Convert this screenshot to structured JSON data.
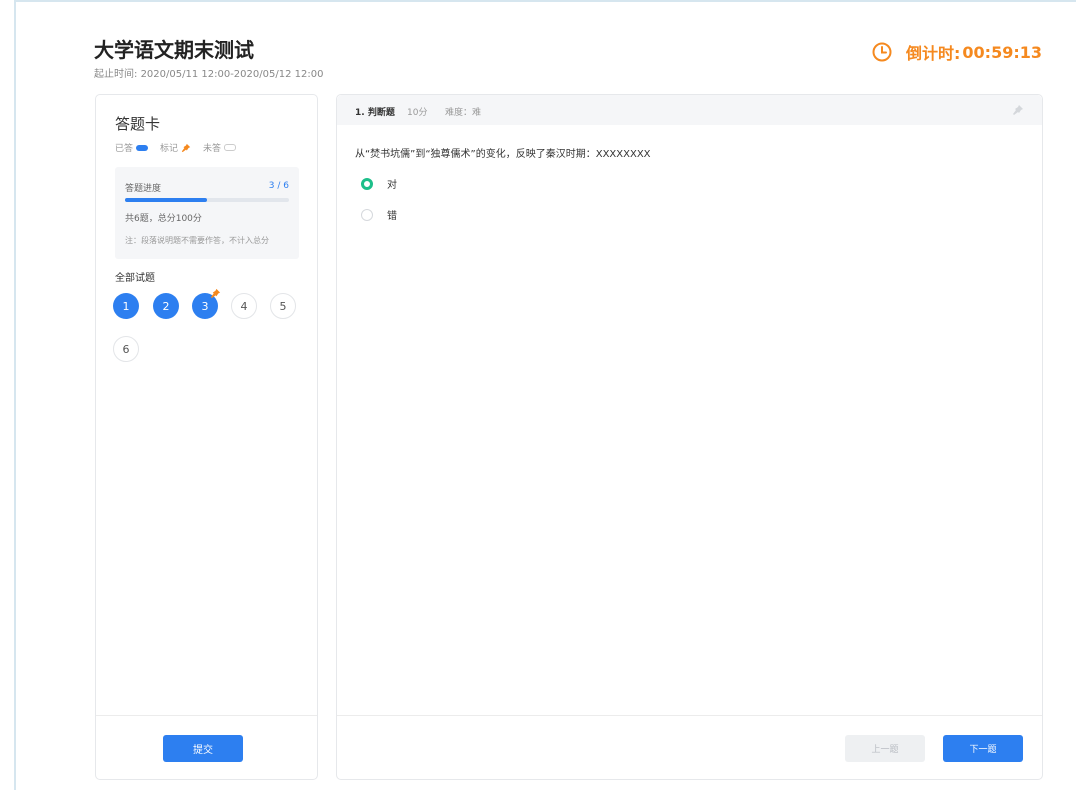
{
  "header": {
    "title": "大学语文期末测试",
    "time_range_label": "起止时间:",
    "time_range": "2020/05/11 12:00-2020/05/12 12:00",
    "countdown_label": "倒计时:",
    "countdown_value": "00:59:13",
    "countdown_color": "#f5891f"
  },
  "answer_card": {
    "title": "答题卡",
    "legend": {
      "answered": "已答",
      "marked": "标记",
      "unanswered": "未答"
    },
    "progress": {
      "label": "答题进度",
      "count": "3 / 6",
      "answered": 3,
      "total": 6,
      "summary": "共6题，总分100分",
      "note": "注：段落说明题不需要作答，不计入总分"
    },
    "all_questions_label": "全部试题",
    "questions": [
      {
        "number": "1",
        "state": "done",
        "marked": false
      },
      {
        "number": "2",
        "state": "done",
        "marked": false
      },
      {
        "number": "3",
        "state": "done",
        "marked": true
      },
      {
        "number": "4",
        "state": "todo",
        "marked": false
      },
      {
        "number": "5",
        "state": "todo",
        "marked": false
      },
      {
        "number": "6",
        "state": "todo",
        "marked": false
      }
    ],
    "submit_label": "提交"
  },
  "question": {
    "index_type": "1. 判断题",
    "score": "10分",
    "difficulty": "难度：难",
    "text": "从“焚书坑儒”到“独尊儒术”的变化，反映了秦汉时期：XXXXXXXX",
    "options": [
      {
        "label": "对",
        "selected": true
      },
      {
        "label": "错",
        "selected": false
      }
    ],
    "prev_label": "上一题",
    "next_label": "下一题"
  },
  "colors": {
    "primary": "#2d7ff0",
    "selected_radio": "#1dbf8a",
    "mark_pin": "#f5891f"
  }
}
